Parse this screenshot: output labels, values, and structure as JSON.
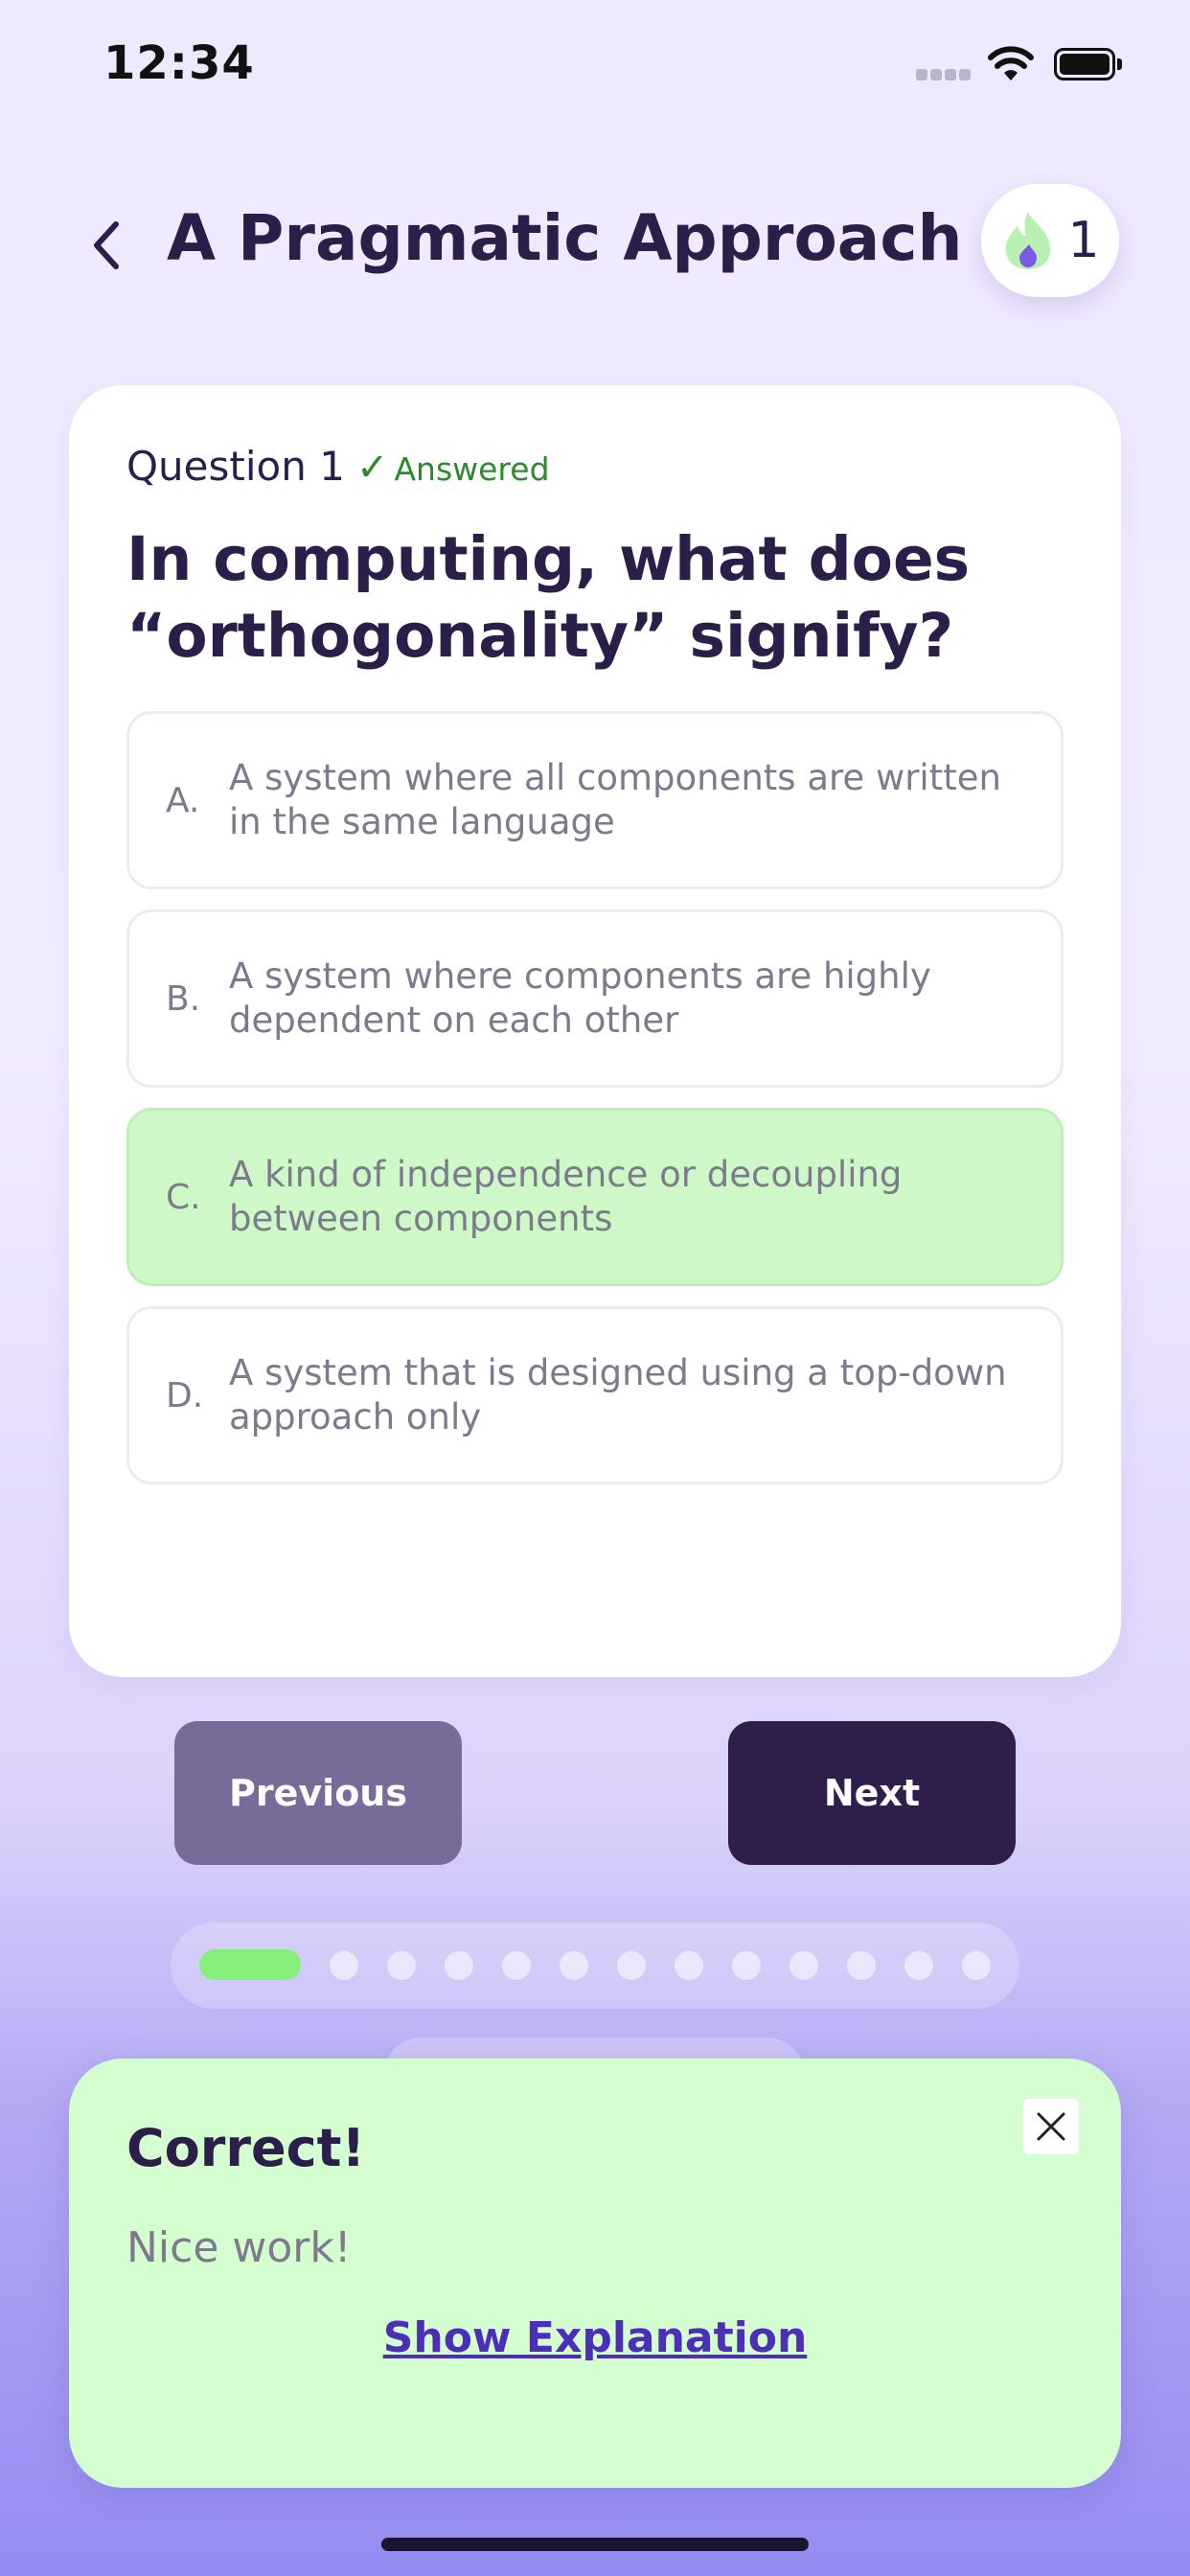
{
  "status_bar": {
    "time": "12:34"
  },
  "header": {
    "title": "A Pragmatic Approach",
    "streak_count": "1"
  },
  "question": {
    "number_label": "Question 1",
    "status_label": "Answered",
    "text": "In computing, what does “orthogonality” signify?",
    "options": [
      {
        "letter": "A.",
        "text": "A system where all components are written in the same language"
      },
      {
        "letter": "B.",
        "text": "A system where components are highly dependent on each other"
      },
      {
        "letter": "C.",
        "text": "A kind of independence or decoupling between components"
      },
      {
        "letter": "D.",
        "text": "A system that is designed using a top-down approach only"
      }
    ],
    "selected_option": "C."
  },
  "navigation": {
    "previous_label": "Previous",
    "next_label": "Next"
  },
  "progress": {
    "total": 13,
    "current": 1
  },
  "feedback": {
    "title": "Correct!",
    "message": "Nice work!",
    "explanation_link": "Show Explanation"
  },
  "colors": {
    "accent_dark": "#2f1d4c",
    "correct_bg": "#d4fdd0",
    "progress_active": "#86ee7b",
    "link": "#4b2fb8"
  }
}
